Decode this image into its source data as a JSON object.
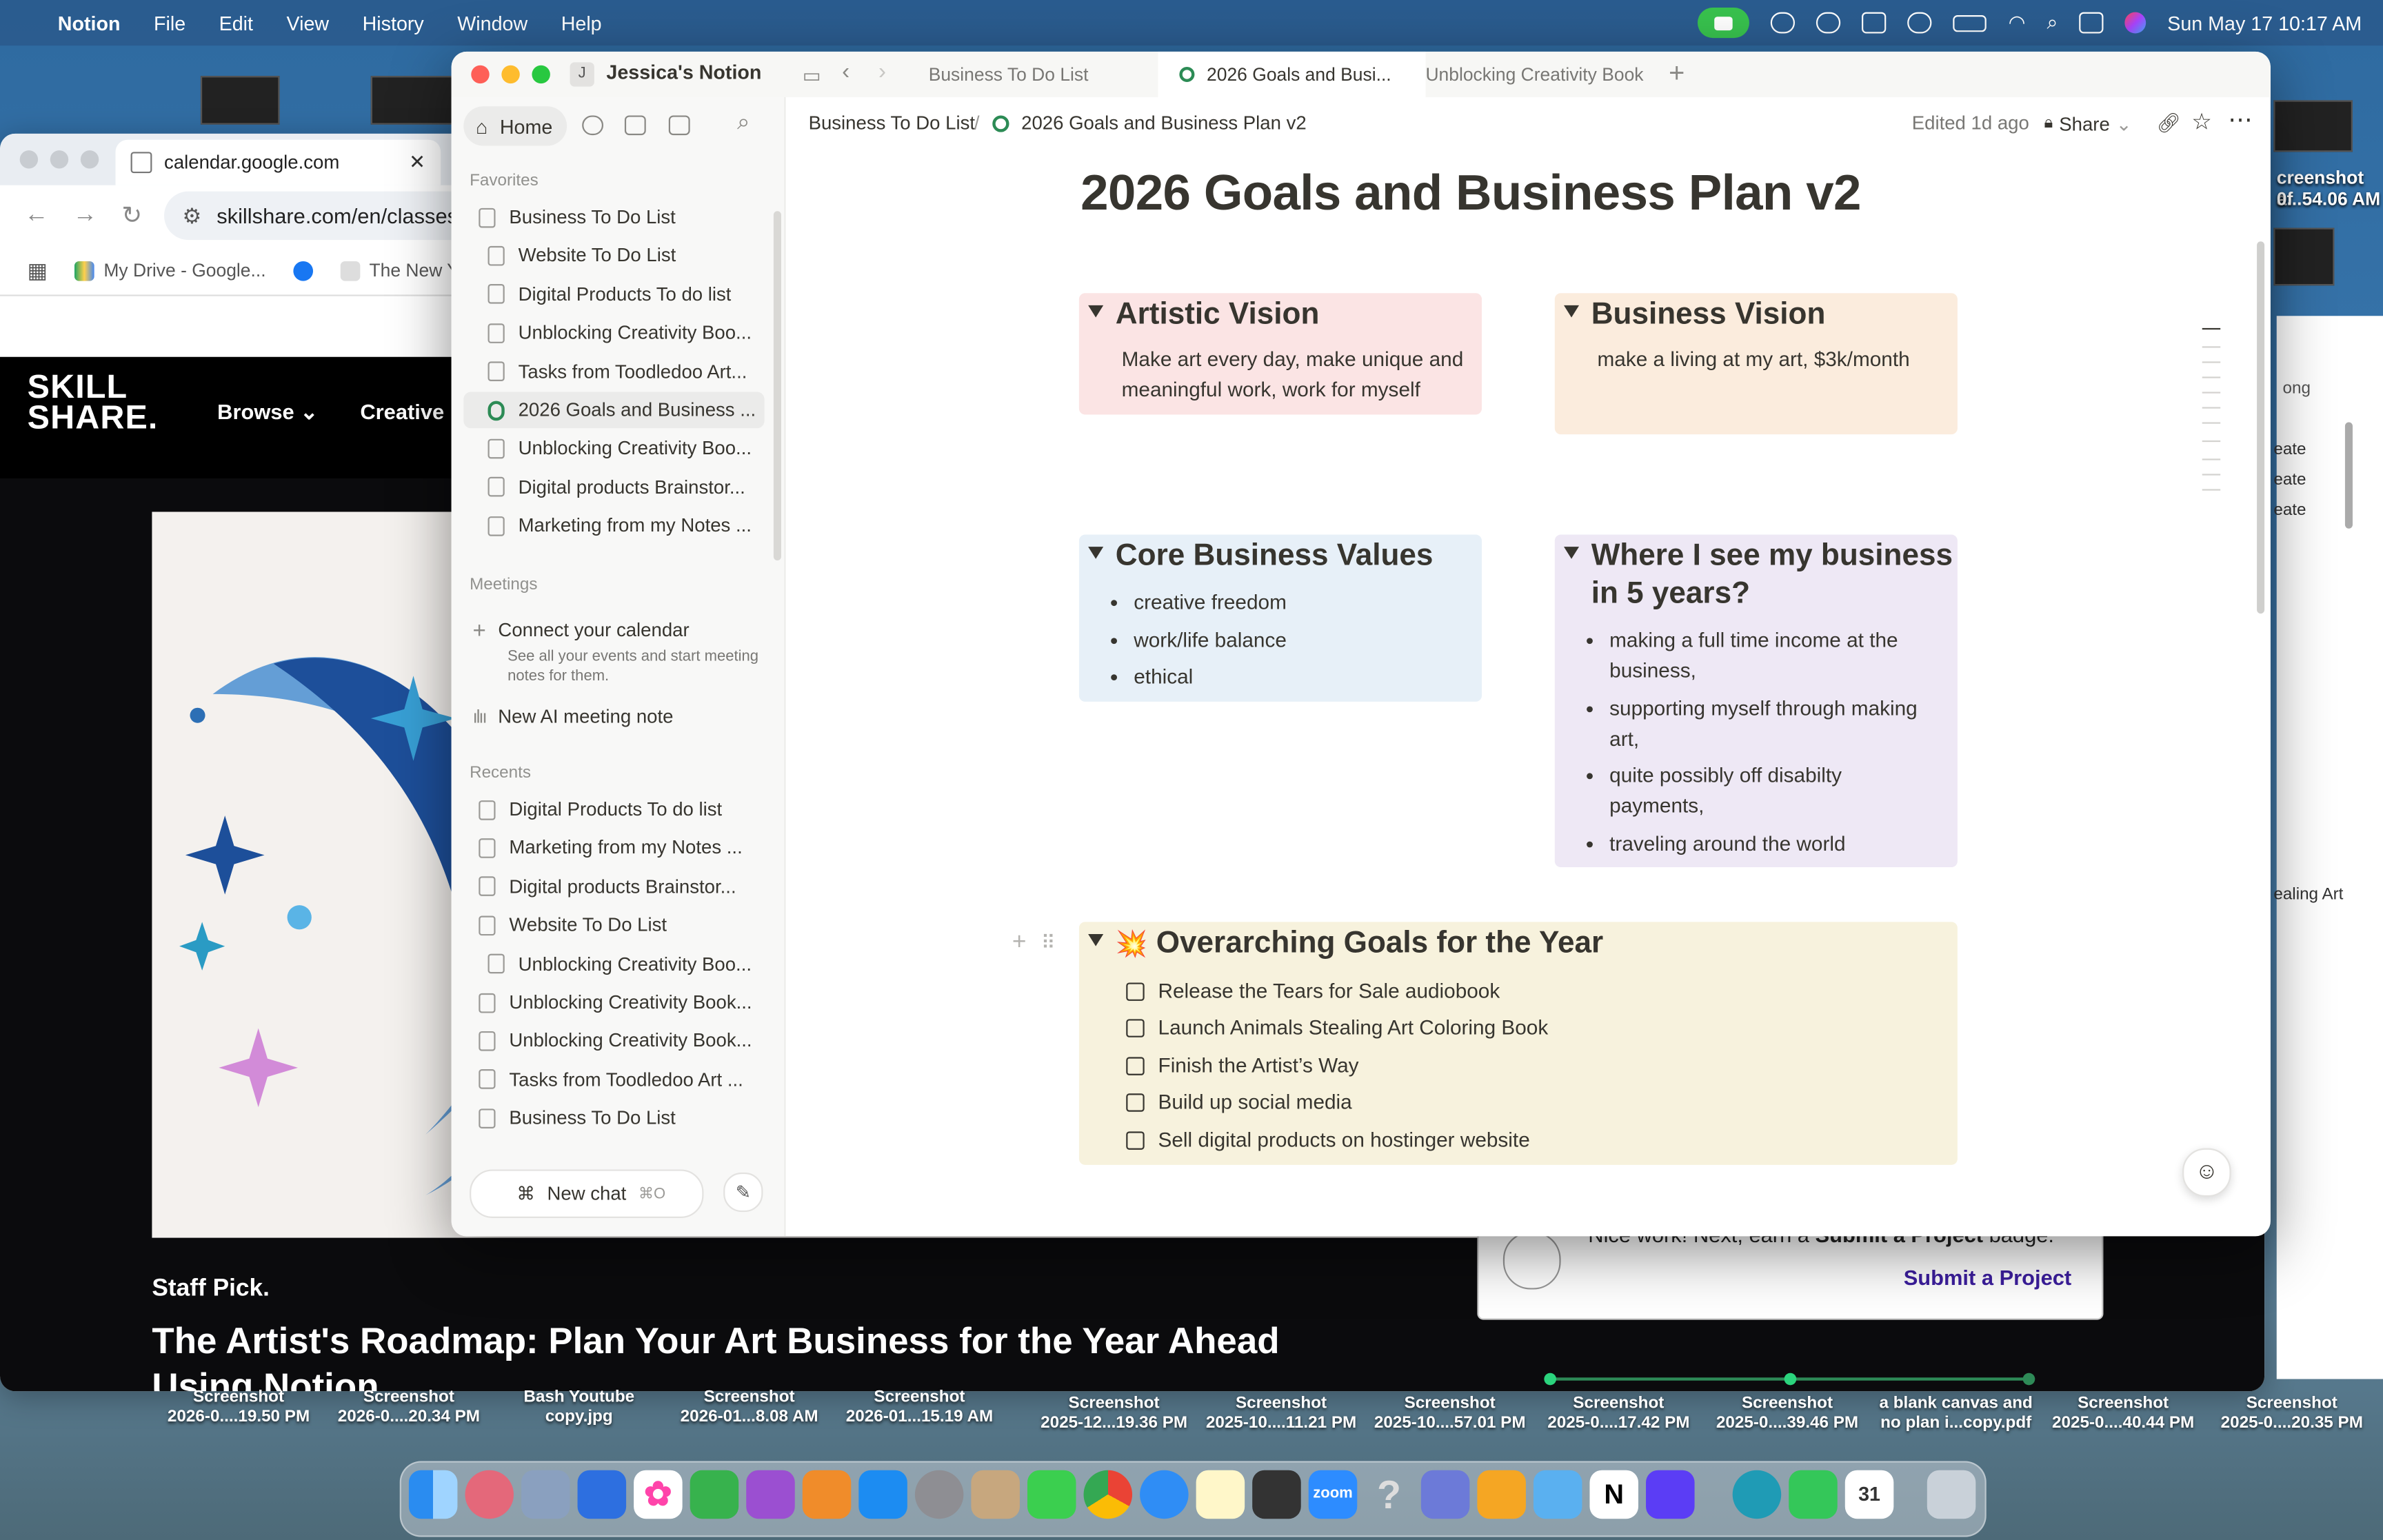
{
  "menubar": {
    "app": "Notion",
    "items": [
      "File",
      "Edit",
      "View",
      "History",
      "Window",
      "Help"
    ],
    "clock": "Sun May 17  10:17 AM"
  },
  "chrome": {
    "tab_title": "calendar.google.com",
    "url": "skillshare.com/en/classes/",
    "bookmarks": [
      "My Drive - Google...",
      "The New Y"
    ]
  },
  "skillshare": {
    "logo_line1": "SKILL",
    "logo_line2": "SHARE.",
    "nav_browse": "Browse",
    "nav_creative": "Creative",
    "staff_pick": "Staff Pick.",
    "class_title": "The Artist's Roadmap: Plan Your Art Business for the Year Ahead",
    "class_title_overflow": "Using Notion",
    "badge_text_pre": "Nice work! Next, earn a ",
    "badge_text_bold": "Submit a Project",
    "badge_text_post": " badge.",
    "submit_link": "Submit a Project"
  },
  "right_strip": {
    "label_top": "creenshot af",
    "label_time": "0...54.06 AM",
    "items": [
      "ong",
      "eate",
      "eate",
      "eate"
    ],
    "bottom": "ealing Art"
  },
  "notion": {
    "workspace": "Jessica's Notion",
    "workspace_initial": "J",
    "tabs": [
      "Business To Do List",
      "2026 Goals and Busi...",
      "Unblocking Creativity Book"
    ],
    "breadcrumb": [
      "Business To Do List",
      "2026 Goals and Business Plan v2"
    ],
    "edited": "Edited 1d ago",
    "share": "Share",
    "sidebar": {
      "home": "Home",
      "favorites_label": "Favorites",
      "favorites": [
        "Business To Do List",
        "Website To Do List",
        "Digital Products To do list",
        "Unblocking Creativity Boo...",
        "Tasks from Toodledoo Art...",
        "2026 Goals and Business ...",
        "Unblocking Creativity Boo...",
        "Digital products Brainstor...",
        "Marketing from my Notes ..."
      ],
      "meetings_label": "Meetings",
      "connect_calendar": "Connect your calendar",
      "connect_calendar_desc": "See all your events and start meeting notes for them.",
      "new_meeting": "New AI meeting note",
      "recents_label": "Recents",
      "recents": [
        "Digital Products To do list",
        "Marketing from my Notes ...",
        "Digital products Brainstor...",
        "Website To Do List",
        "Unblocking Creativity Boo...",
        "Unblocking Creativity Book...",
        "Unblocking Creativity Book...",
        "Tasks from Toodledoo Art ...",
        "Business To Do List"
      ],
      "new_chat": "New chat",
      "new_chat_shortcut": "⌘O"
    },
    "page": {
      "title": "2026 Goals and Business Plan v2",
      "artistic_vision": {
        "heading": "Artistic Vision",
        "text": "Make art every day, make unique and meaningful work, work for myself",
        "color": "#fbe4e4"
      },
      "business_vision": {
        "heading": "Business Vision",
        "text": "make a living at my art, $3k/month",
        "color": "#fbecdd"
      },
      "core_values": {
        "heading": "Core Business Values",
        "items": [
          "creative freedom",
          "work/life balance",
          "ethical"
        ],
        "color": "#e7f0f8"
      },
      "five_years": {
        "heading_line1": "Where I see my business",
        "heading_line2": "in 5 years?",
        "items": [
          "making a full time income at the business,",
          "supporting myself through making art,",
          "quite possibly off disabilty payments,",
          "traveling around the world"
        ],
        "color": "#eee8f5"
      },
      "goals": {
        "emoji": "💥",
        "heading": "Overarching Goals for the Year",
        "todos": [
          "Release the Tears for Sale audiobook",
          "Launch Animals Stealing Art Coloring Book",
          "Finish the Artist’s Way",
          "Build up social media",
          "Sell digital products on hostinger website"
        ],
        "color": "#f7f2dd"
      }
    }
  },
  "desktop_files": [
    {
      "line1": "Screenshot",
      "line2": "2026-0....19.50 PM"
    },
    {
      "line1": "Screenshot",
      "line2": "2026-0....20.34 PM"
    },
    {
      "line1": "Bash Youtube",
      "line2": "copy.jpg"
    },
    {
      "line1": "Screenshot",
      "line2": "2026-01...8.08 AM"
    },
    {
      "line1": "Screenshot",
      "line2": "2026-01...15.19 AM"
    },
    {
      "line1": "Screenshot",
      "line2": "2025-12...19.36 PM"
    },
    {
      "line1": "Screenshot",
      "line2": "2025-10....11.21 PM"
    },
    {
      "line1": "Screenshot",
      "line2": "2025-10....57.01 PM"
    },
    {
      "line1": "Screenshot",
      "line2": "2025-0....17.42 PM"
    },
    {
      "line1": "Screenshot",
      "line2": "2025-0....39.46 PM"
    },
    {
      "line1": "a blank canvas and",
      "line2": "no plan i...copy.pdf"
    },
    {
      "line1": "Screenshot",
      "line2": "2025-0....40.44 PM"
    },
    {
      "line1": "Screenshot",
      "line2": "2025-0....20.35 PM"
    }
  ],
  "dock": {
    "zoom_label": "zoom",
    "calendar_day": "31",
    "notion_letter": "N",
    "help_glyph": "?"
  }
}
